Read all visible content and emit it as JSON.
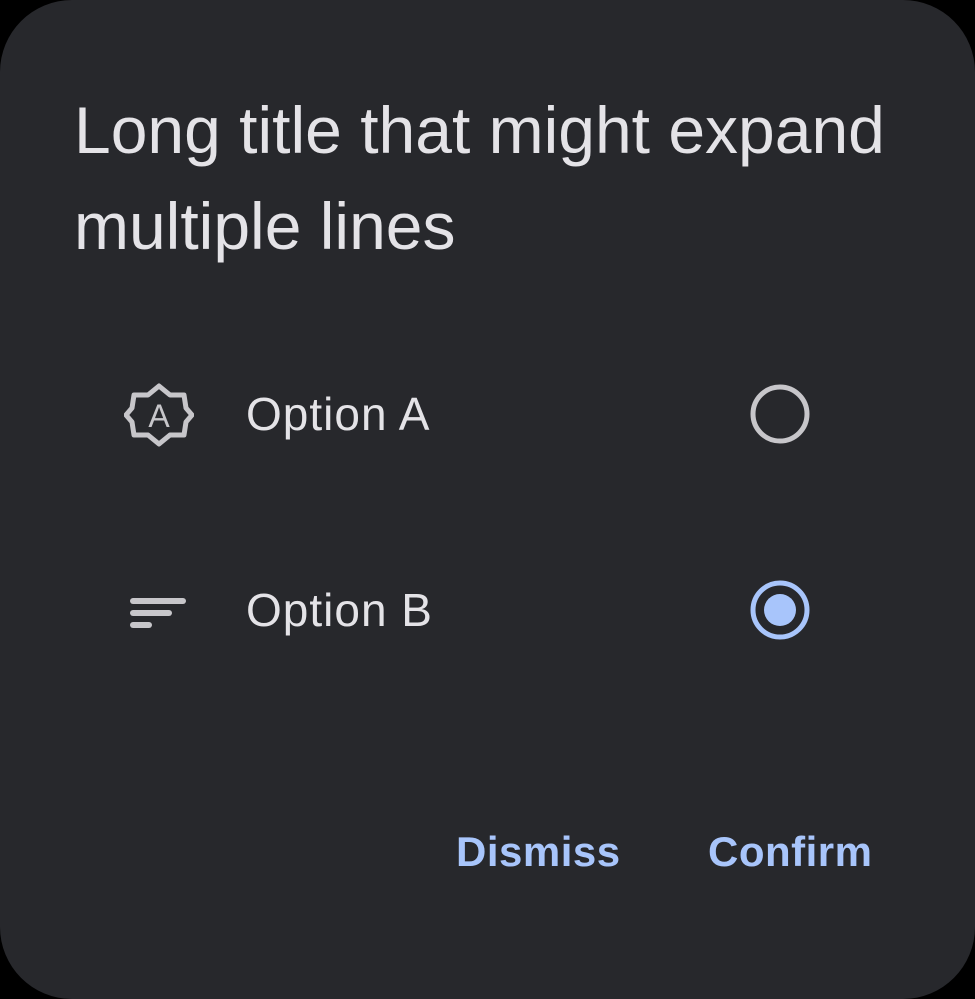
{
  "dialog": {
    "title": "Long title that might expand multiple lines",
    "options": [
      {
        "label": "Option A",
        "icon": "auto-mode-badge-icon",
        "selected": false
      },
      {
        "label": "Option B",
        "icon": "sort-lines-icon",
        "selected": true
      }
    ],
    "actions": {
      "dismiss_label": "Dismiss",
      "confirm_label": "Confirm"
    }
  },
  "colors": {
    "background": "#000000",
    "surface": "#27282c",
    "text": "#e4e3e7",
    "accent": "#a8c5fb",
    "radio_unselected": "#c7c6ca"
  }
}
